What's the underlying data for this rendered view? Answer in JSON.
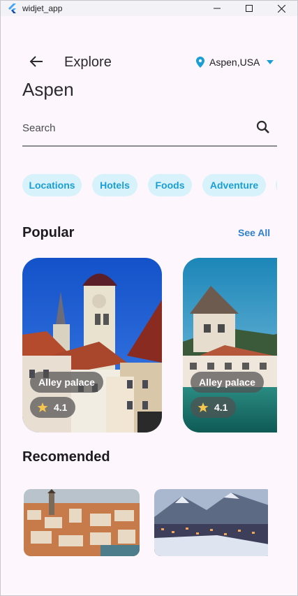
{
  "window": {
    "title": "widjet_app"
  },
  "header": {
    "title": "Explore",
    "location": "Aspen,USA",
    "city": "Aspen"
  },
  "search": {
    "placeholder": "Search"
  },
  "categories": [
    "Locations",
    "Hotels",
    "Foods",
    "Adventure"
  ],
  "popular": {
    "title": "Popular",
    "see_all": "See All",
    "cards": [
      {
        "name": "Alley palace",
        "rating": "4.1"
      },
      {
        "name": "Alley palace",
        "rating": "4.1"
      }
    ]
  },
  "recommended": {
    "title": "Recomended"
  },
  "colors": {
    "accent": "#1a9ed6",
    "chip_bg": "#d7f2fa",
    "link": "#2f80d1",
    "background": "#fdf7fd",
    "star": "#f6c54d"
  }
}
